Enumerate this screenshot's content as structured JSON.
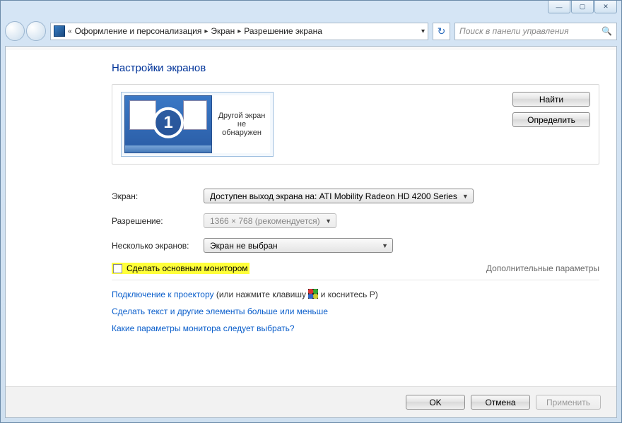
{
  "window": {
    "minimize_glyph": "—",
    "maximize_glyph": "▢",
    "close_glyph": "✕"
  },
  "address": {
    "chevrons": "«",
    "seg1": "Оформление и персонализация",
    "seg2": "Экран",
    "seg3": "Разрешение экрана"
  },
  "search": {
    "placeholder": "Поиск в панели управления"
  },
  "page": {
    "title": "Настройки экранов"
  },
  "monitors": {
    "primary_number": "1",
    "secondary_text": "Другой экран не обнаружен"
  },
  "buttons": {
    "find": "Найти",
    "identify": "Определить"
  },
  "form": {
    "display_label": "Экран:",
    "display_value": "Доступен выход экрана на: ATI Mobility Radeon HD 4200 Series",
    "resolution_label": "Разрешение:",
    "resolution_value": "1366 × 768 (рекомендуется)",
    "multi_label": "Несколько экранов:",
    "multi_value": "Экран не выбран"
  },
  "checkbox": {
    "label": "Сделать основным монитором"
  },
  "adv_link": "Дополнительные параметры",
  "projector": {
    "link": "Подключение к проектору",
    "prefix": " (или нажмите клавишу ",
    "suffix": " и коснитесь P)"
  },
  "links": {
    "larger_text": "Сделать текст и другие элементы больше или меньше",
    "which_monitor": "Какие параметры монитора следует выбрать?"
  },
  "footer": {
    "ok": "OK",
    "cancel": "Отмена",
    "apply": "Применить"
  }
}
